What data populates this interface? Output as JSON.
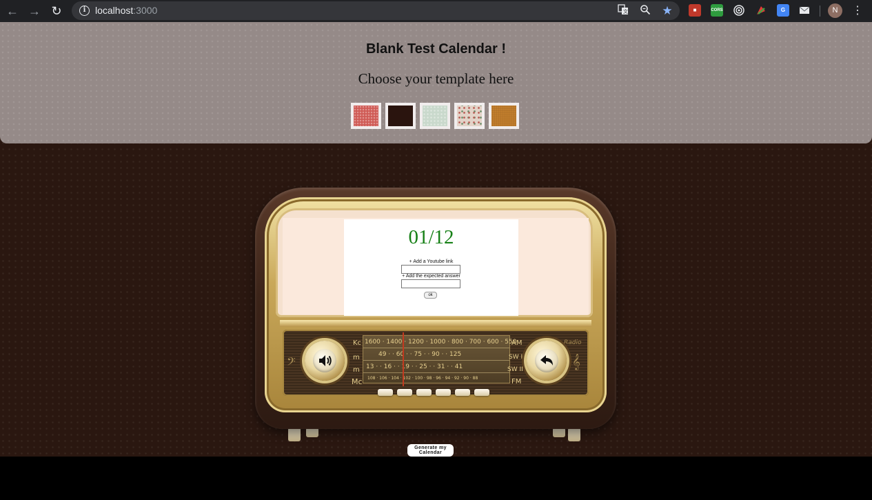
{
  "browser": {
    "url_host": "localhost",
    "url_port": ":3000",
    "info_icon": "i",
    "profile_initial": "N",
    "extensions": [
      "translate-icon",
      "zoom-icon",
      "star-icon",
      "ext-red-icon",
      "ext-cors-icon",
      "ext-target-icon",
      "ext-color-icon",
      "ext-translate-icon",
      "ext-mail-icon"
    ],
    "ext_cors_label": "CORS"
  },
  "header": {
    "title": "Blank Test Calendar !",
    "subtitle": "Choose your template here",
    "templates": [
      {
        "name": "red-pattern",
        "color": "#cf5a55"
      },
      {
        "name": "dark-brown",
        "color": "#2a140e"
      },
      {
        "name": "mint-pattern",
        "color": "#c9d9cc"
      },
      {
        "name": "floral-pattern",
        "color": "#e3d3c8"
      },
      {
        "name": "orange-leather",
        "color": "#c8822e"
      }
    ]
  },
  "radio": {
    "band_labels": [
      "Kc",
      "m",
      "m",
      "Mc"
    ],
    "right_labels": [
      "AM",
      "SW I",
      "SW II",
      "FM"
    ],
    "brand": "Radio",
    "scale_row1": "1600 · 1400 · 1200 · 1000 · 800 · 700 · 600 · 550",
    "scale_row2": "49 · · 60 · · 75 · · 90 · · 125",
    "scale_row3": "13 · · 16 · · 19 · · 25 · · 31 · · 41",
    "scale_row4": "108 · 106 · 104 · 102 · 100 · 98 · 96 · 94 · 92 · 90 · 88",
    "left_knob_icon": "speaker-icon",
    "right_knob_icon": "back-arrow-icon"
  },
  "card": {
    "date": "01/12",
    "youtube_label": "+ Add a Youtube link",
    "youtube_value": "",
    "answer_label": "+ Add the expected answer",
    "answer_value": "",
    "ok_label": "ok"
  },
  "actions": {
    "generate_label": "Generate my Calendar"
  },
  "colors": {
    "date_green": "#168016",
    "header_bg": "#958a88",
    "stage_bg": "#2a1710"
  }
}
